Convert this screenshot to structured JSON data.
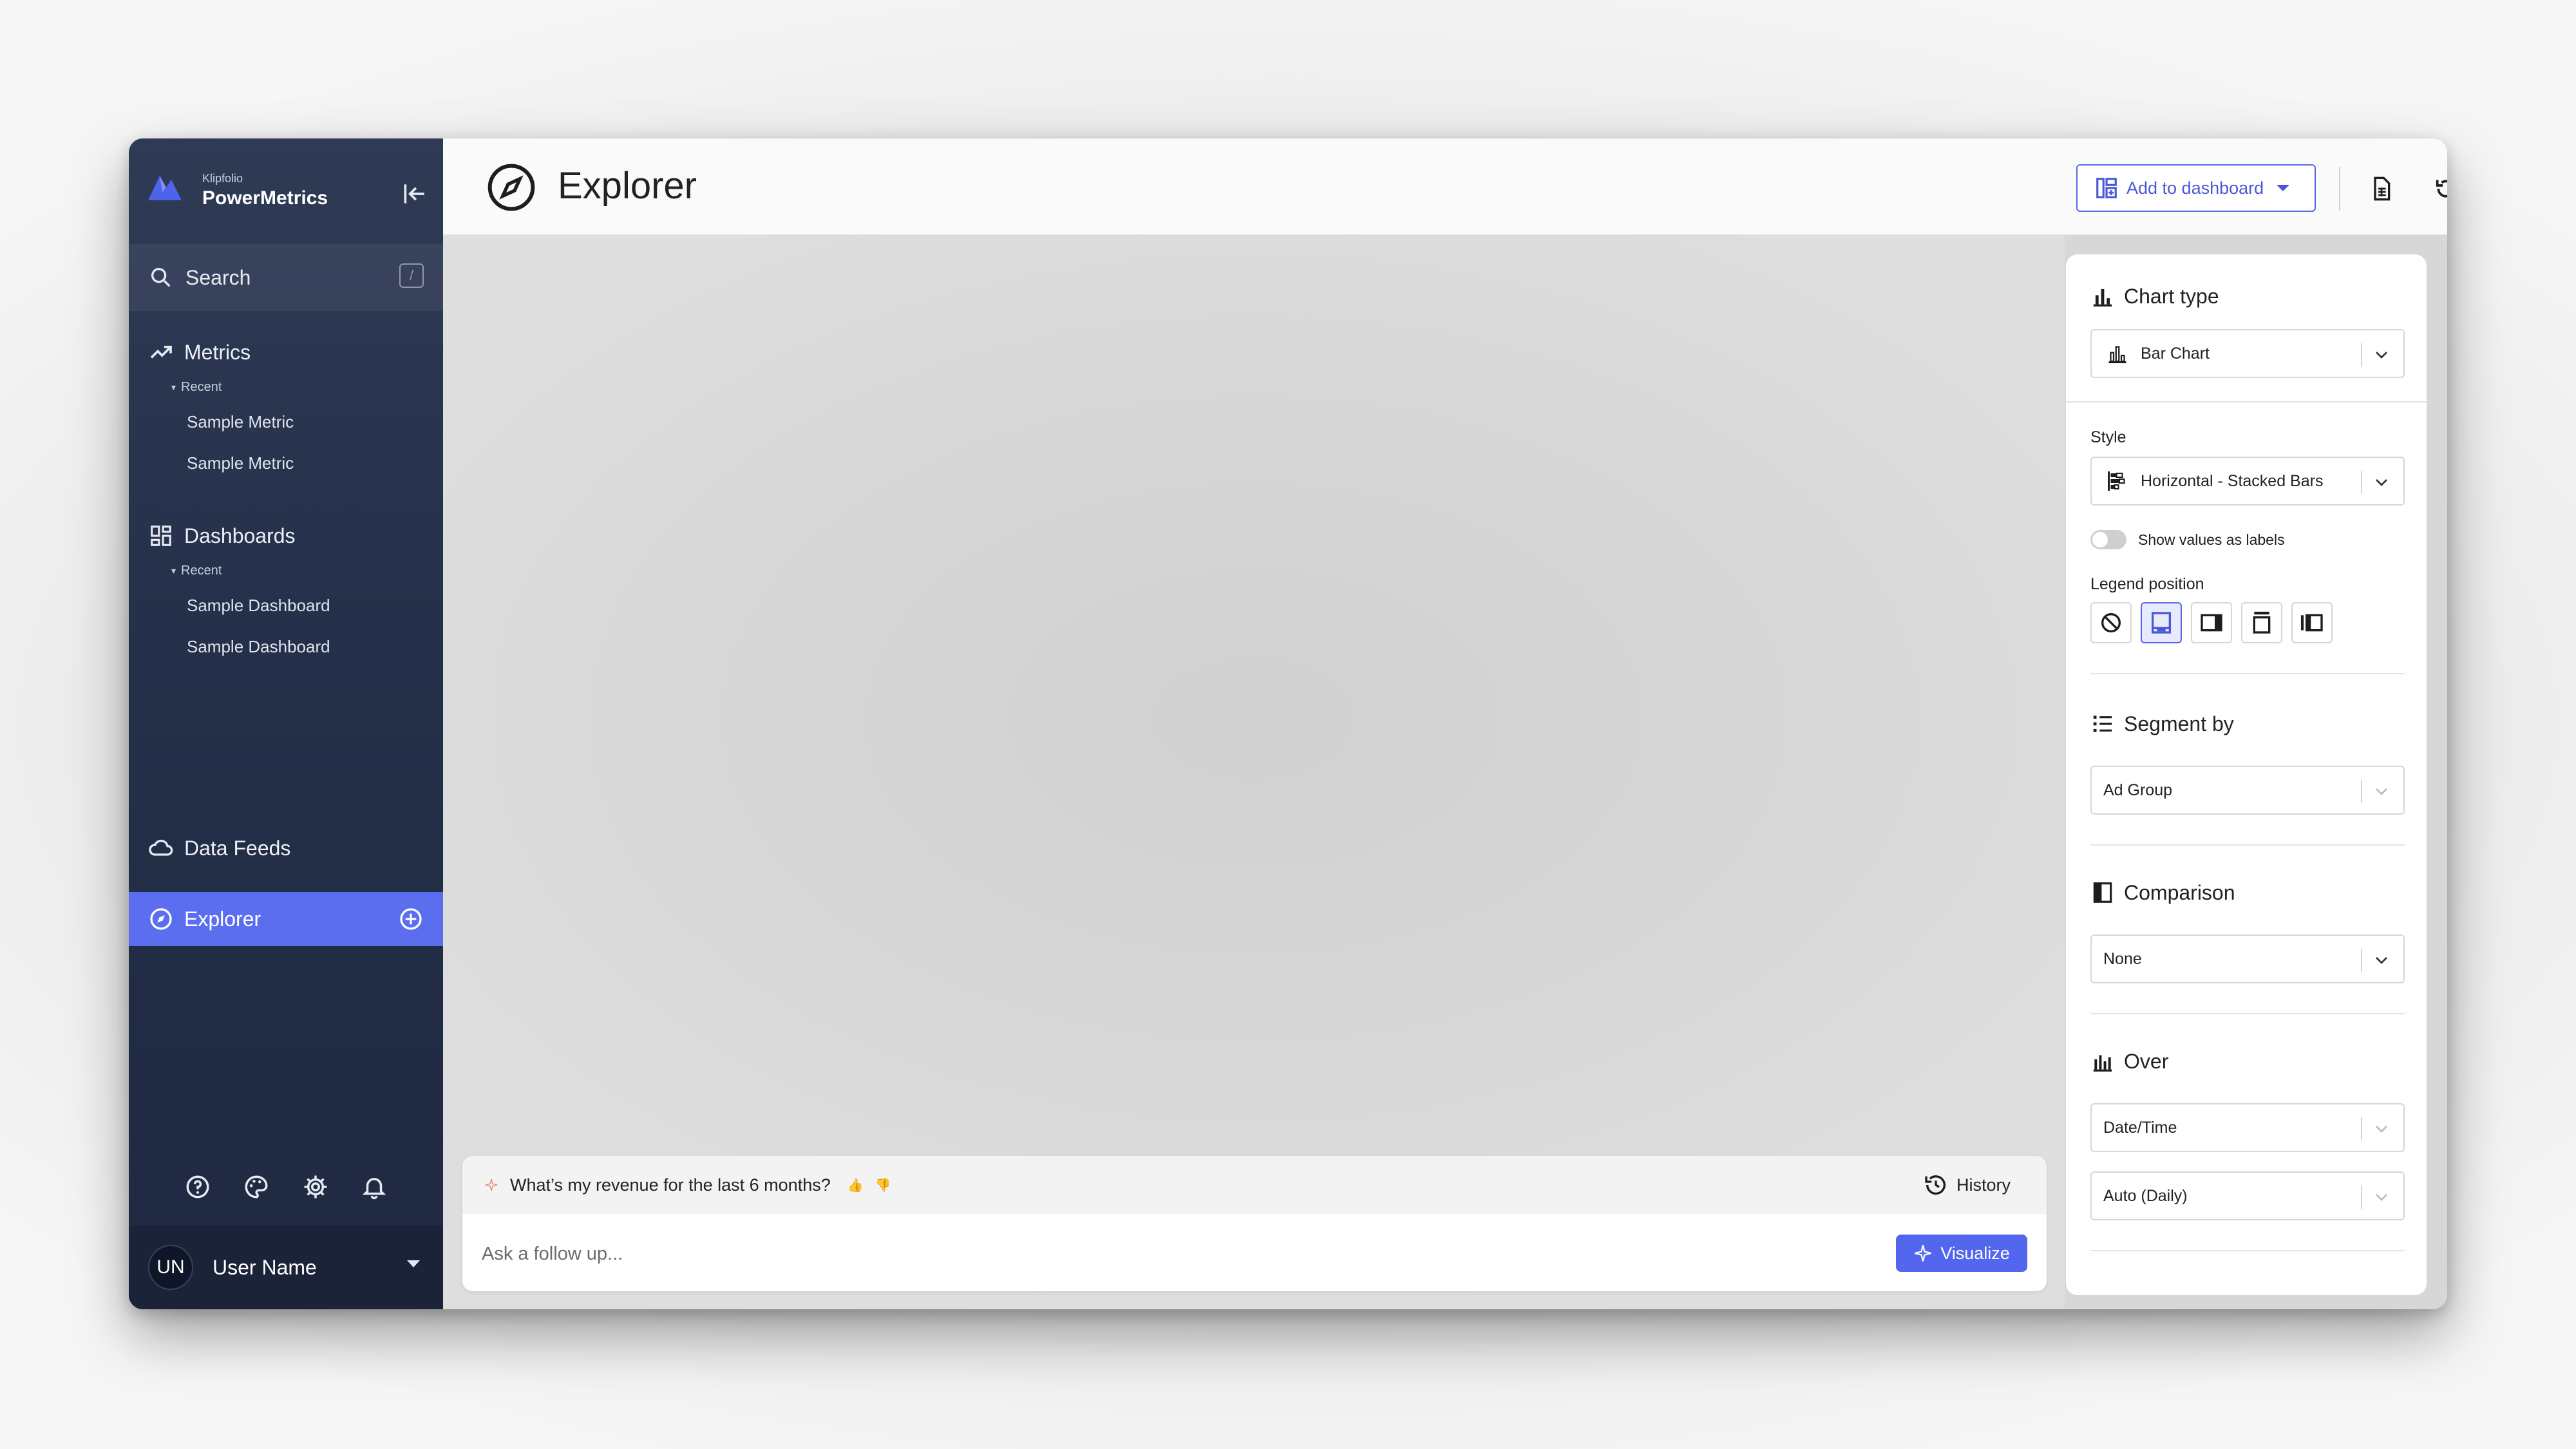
{
  "brand": {
    "small": "Klipfolio",
    "name": "PowerMetrics"
  },
  "sidebar": {
    "search_label": "Search",
    "search_shortcut": "/",
    "sections": [
      {
        "label": "Metrics",
        "icon": "trend-up-icon",
        "recent_label": "Recent",
        "items": [
          "Sample Metric",
          "Sample Metric"
        ]
      },
      {
        "label": "Dashboards",
        "icon": "dashboard-grid-icon",
        "recent_label": "Recent",
        "items": [
          "Sample Dashboard",
          "Sample Dashboard"
        ]
      }
    ],
    "data_feeds_label": "Data Feeds",
    "explorer_label": "Explorer",
    "user": {
      "initials": "UN",
      "name": "User Name"
    }
  },
  "header": {
    "title": "Explorer",
    "add_to_dashboard": "Add to dashboard"
  },
  "prompt": {
    "question": "What’s my revenue for the last 6 months?",
    "thumb_up": "👍",
    "thumb_down": "👎",
    "history_label": "History",
    "followup_placeholder": "Ask a follow up...",
    "visualize_label": "Visualize"
  },
  "panel": {
    "chart_type_title": "Chart type",
    "chart_type_value": "Bar Chart",
    "style_label": "Style",
    "style_value": "Horizontal - Stacked Bars",
    "show_values_label": "Show values as labels",
    "legend_position_label": "Legend position",
    "segment_by_title": "Segment by",
    "segment_by_value": "Ad Group",
    "comparison_title": "Comparison",
    "comparison_value": "None",
    "over_title": "Over",
    "over_value": "Date/Time",
    "interval_value": "Auto (Daily)"
  },
  "colors": {
    "accent": "#5366ee",
    "sidebar_bg": "#243049",
    "explorer_active": "#5b6ef0"
  }
}
